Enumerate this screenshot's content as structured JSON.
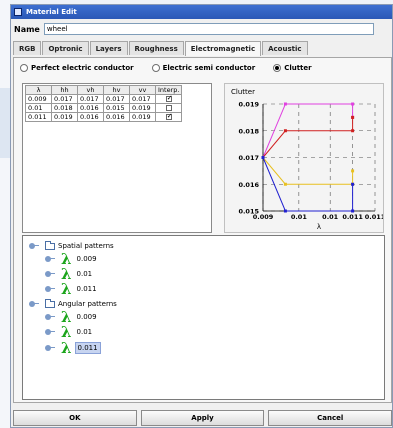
{
  "window": {
    "title": "Material Edit"
  },
  "name_field": {
    "label": "Name",
    "value": "wheel"
  },
  "tabs": [
    "RGB",
    "Optronic",
    "Layers",
    "Roughness",
    "Electromagnetic",
    "Acoustic"
  ],
  "active_tab": "Electromagnetic",
  "radios": [
    {
      "label": "Perfect electric conductor",
      "checked": false
    },
    {
      "label": "Electric semi conductor",
      "checked": false
    },
    {
      "label": "Clutter",
      "checked": true
    }
  ],
  "table": {
    "headers": [
      "λ",
      "hh",
      "vh",
      "hv",
      "vv",
      "Interp."
    ],
    "rows": [
      {
        "cells": [
          "0.009",
          "0.017",
          "0.017",
          "0.017",
          "0.017"
        ],
        "interp": true
      },
      {
        "cells": [
          "0.01",
          "0.018",
          "0.016",
          "0.015",
          "0.019"
        ],
        "interp": false
      },
      {
        "cells": [
          "0.011",
          "0.019",
          "0.016",
          "0.016",
          "0.019"
        ],
        "interp": true
      }
    ]
  },
  "chart_data": {
    "type": "line",
    "title": "Clutter",
    "xlabel": "λ",
    "ylabel": "",
    "x_ticks": [
      "0.009",
      "0.01",
      "0.01",
      "0.011",
      "0.011"
    ],
    "y_ticks": [
      "0.015",
      "0.016",
      "0.017",
      "0.018",
      "0.019"
    ],
    "ylim": [
      0.015,
      0.019
    ],
    "xlim": [
      0.009,
      0.0115
    ],
    "grid": true,
    "series": [
      {
        "color": "#e040e0",
        "x": [
          0.009,
          0.0095,
          0.011,
          0.011
        ],
        "y": [
          0.017,
          0.019,
          0.019,
          0.0185
        ]
      },
      {
        "color": "#d02020",
        "x": [
          0.009,
          0.0095,
          0.011,
          0.011
        ],
        "y": [
          0.017,
          0.018,
          0.018,
          0.0185
        ]
      },
      {
        "color": "#e8c020",
        "x": [
          0.009,
          0.0095,
          0.011,
          0.011
        ],
        "y": [
          0.017,
          0.016,
          0.016,
          0.0165
        ]
      },
      {
        "color": "#2020d0",
        "x": [
          0.009,
          0.0095,
          0.011,
          0.011
        ],
        "y": [
          0.017,
          0.015,
          0.015,
          0.016
        ]
      }
    ]
  },
  "tree": {
    "groups": [
      {
        "label": "Spatial patterns",
        "children": [
          "0.009",
          "0.01",
          "0.011"
        ]
      },
      {
        "label": "Angular patterns",
        "children": [
          "0.009",
          "0.01",
          "0.011"
        ]
      }
    ],
    "selected": "Angular patterns/0.011"
  },
  "buttons": {
    "ok": "OK",
    "apply": "Apply",
    "cancel": "Cancel"
  },
  "icons": {
    "lambda": "lambda-icon",
    "folder": "folder-icon",
    "expander": "tree-expander-icon"
  }
}
